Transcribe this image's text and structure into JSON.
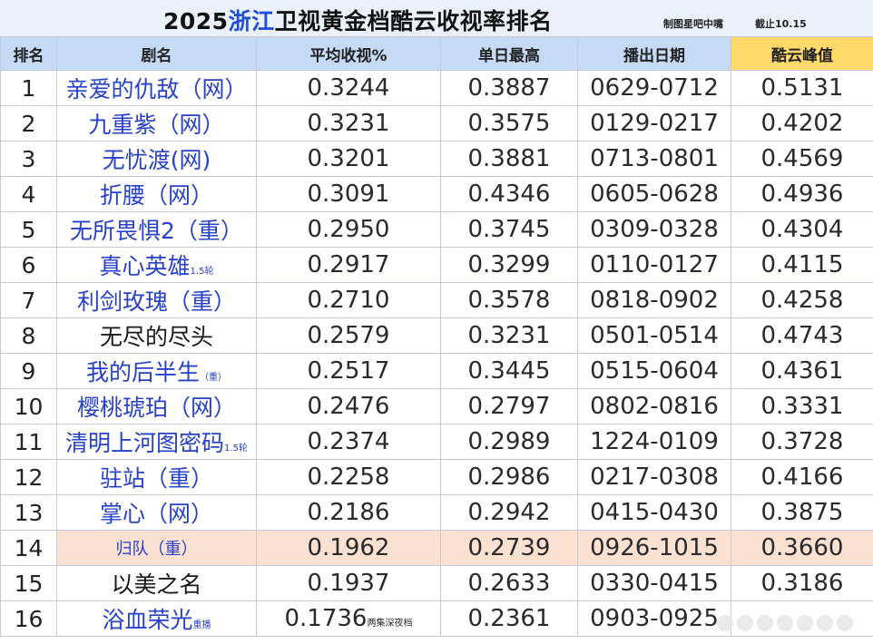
{
  "header": {
    "title_year": "2025",
    "title_highlight": "浙江",
    "title_rest": "卫视黄金档酷云收视率排名",
    "credit": "制图星吧中嘴",
    "cutoff": "截止10.15"
  },
  "columns": [
    "排名",
    "剧名",
    "平均收视%",
    "单日最高",
    "播出日期",
    "酷云峰值"
  ],
  "colors": {
    "title_highlight": "#1f4fd8",
    "header_bg": "#c5daf5",
    "peak_header_bg": "#ffd96a",
    "name_text": "#2741c9",
    "highlight_row_bg": "#fbe1d2"
  },
  "rows": [
    {
      "rank": "1",
      "name": "亲爱的仇敌（网）",
      "name_note": "",
      "avg": "0.3244",
      "avg_note": "",
      "max": "0.3887",
      "dates": "0629-0712",
      "peak": "0.5131"
    },
    {
      "rank": "2",
      "name": "九重紫（网）",
      "name_note": "",
      "avg": "0.3231",
      "avg_note": "",
      "max": "0.3575",
      "dates": "0129-0217",
      "peak": "0.4202"
    },
    {
      "rank": "3",
      "name": "无忧渡(网)",
      "name_note": "",
      "avg": "0.3201",
      "avg_note": "",
      "max": "0.3881",
      "dates": "0713-0801",
      "peak": "0.4569"
    },
    {
      "rank": "4",
      "name": "折腰（网）",
      "name_note": "",
      "avg": "0.3091",
      "avg_note": "",
      "max": "0.4346",
      "dates": "0605-0628",
      "peak": "0.4936"
    },
    {
      "rank": "5",
      "name": "无所畏惧2（重）",
      "name_note": "",
      "avg": "0.2950",
      "avg_note": "",
      "max": "0.3745",
      "dates": "0309-0328",
      "peak": "0.4304"
    },
    {
      "rank": "6",
      "name": "真心英雄",
      "name_note": "1.5轮",
      "avg": "0.2917",
      "avg_note": "",
      "max": "0.3299",
      "dates": "0110-0127",
      "peak": "0.4115"
    },
    {
      "rank": "7",
      "name": "利剑玫瑰（重）",
      "name_note": "",
      "avg": "0.2710",
      "avg_note": "",
      "max": "0.3578",
      "dates": "0818-0902",
      "peak": "0.4258"
    },
    {
      "rank": "8",
      "name": "无尽的尽头",
      "name_note": "",
      "avg": "0.2579",
      "avg_note": "",
      "max": "0.3231",
      "dates": "0501-0514",
      "peak": "0.4743"
    },
    {
      "rank": "9",
      "name": "我的后半生",
      "name_note": "（重）",
      "avg": "0.2517",
      "avg_note": "",
      "max": "0.3445",
      "dates": "0515-0604",
      "peak": "0.4361"
    },
    {
      "rank": "10",
      "name": "樱桃琥珀（网）",
      "name_note": "",
      "avg": "0.2476",
      "avg_note": "",
      "max": "0.2797",
      "dates": "0802-0816",
      "peak": "0.3331"
    },
    {
      "rank": "11",
      "name": "清明上河图密码",
      "name_note": "1.5轮",
      "avg": "0.2374",
      "avg_note": "",
      "max": "0.2989",
      "dates": "1224-0109",
      "peak": "0.3728"
    },
    {
      "rank": "12",
      "name": "驻站（重）",
      "name_note": "",
      "avg": "0.2258",
      "avg_note": "",
      "max": "0.2986",
      "dates": "0217-0308",
      "peak": "0.4166"
    },
    {
      "rank": "13",
      "name": "掌心（网）",
      "name_note": "",
      "avg": "0.2186",
      "avg_note": "",
      "max": "0.2942",
      "dates": "0415-0430",
      "peak": "0.3875"
    },
    {
      "rank": "14",
      "name": "归队（重）",
      "name_note": "",
      "avg": "0.1962",
      "avg_note": "",
      "max": "0.2739",
      "dates": "0926-1015",
      "peak": "0.3660"
    },
    {
      "rank": "15",
      "name": "以美之名",
      "name_note": "",
      "avg": "0.1937",
      "avg_note": "",
      "max": "0.2633",
      "dates": "0330-0415",
      "peak": "0.3186"
    },
    {
      "rank": "16",
      "name": "浴血荣光",
      "name_note": "重播",
      "avg": "0.1736",
      "avg_note": "两集深夜档",
      "max": "0.2361",
      "dates": "0903-0925",
      "peak": ""
    }
  ]
}
